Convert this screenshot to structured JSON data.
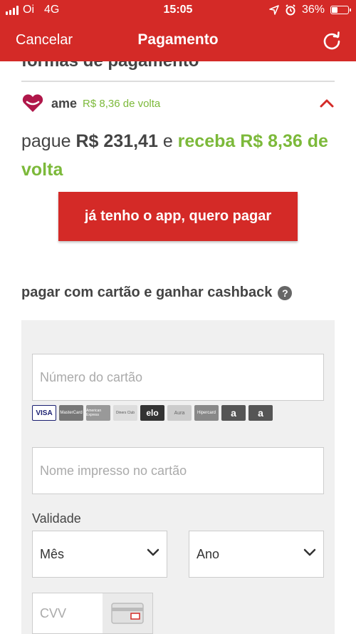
{
  "status_bar": {
    "carrier": "Oi",
    "network": "4G",
    "time": "15:05",
    "battery": "36%"
  },
  "nav": {
    "cancel_label": "Cancelar",
    "title": "Pagamento"
  },
  "section": {
    "title": "formas de pagamento"
  },
  "ame": {
    "name": "ame",
    "cashback_text": "R$ 8,36 de volta"
  },
  "payment_summary": {
    "prefix": "pague",
    "amount": "R$ 231,41",
    "connector": "e",
    "cashback": "receba R$ 8,36 de volta"
  },
  "app_button": {
    "label": "já tenho o app, quero pagar"
  },
  "card_section": {
    "title": "pagar com cartão e ganhar cashback",
    "help": "?",
    "card_number_placeholder": "Número do cartão",
    "brands": [
      "VISA",
      "MasterCard",
      "American Express",
      "Diners Club",
      "elo",
      "Aura",
      "Hipercard",
      "a",
      "a"
    ],
    "name_placeholder": "Nome impresso no cartão",
    "validity_label": "Validade",
    "month_label": "Mês",
    "year_label": "Ano",
    "cvv_placeholder": "CVV"
  },
  "colors": {
    "brand_red": "#d42a27",
    "cashback_green": "#7cb93a",
    "panel_gray": "#f0f0f0"
  }
}
